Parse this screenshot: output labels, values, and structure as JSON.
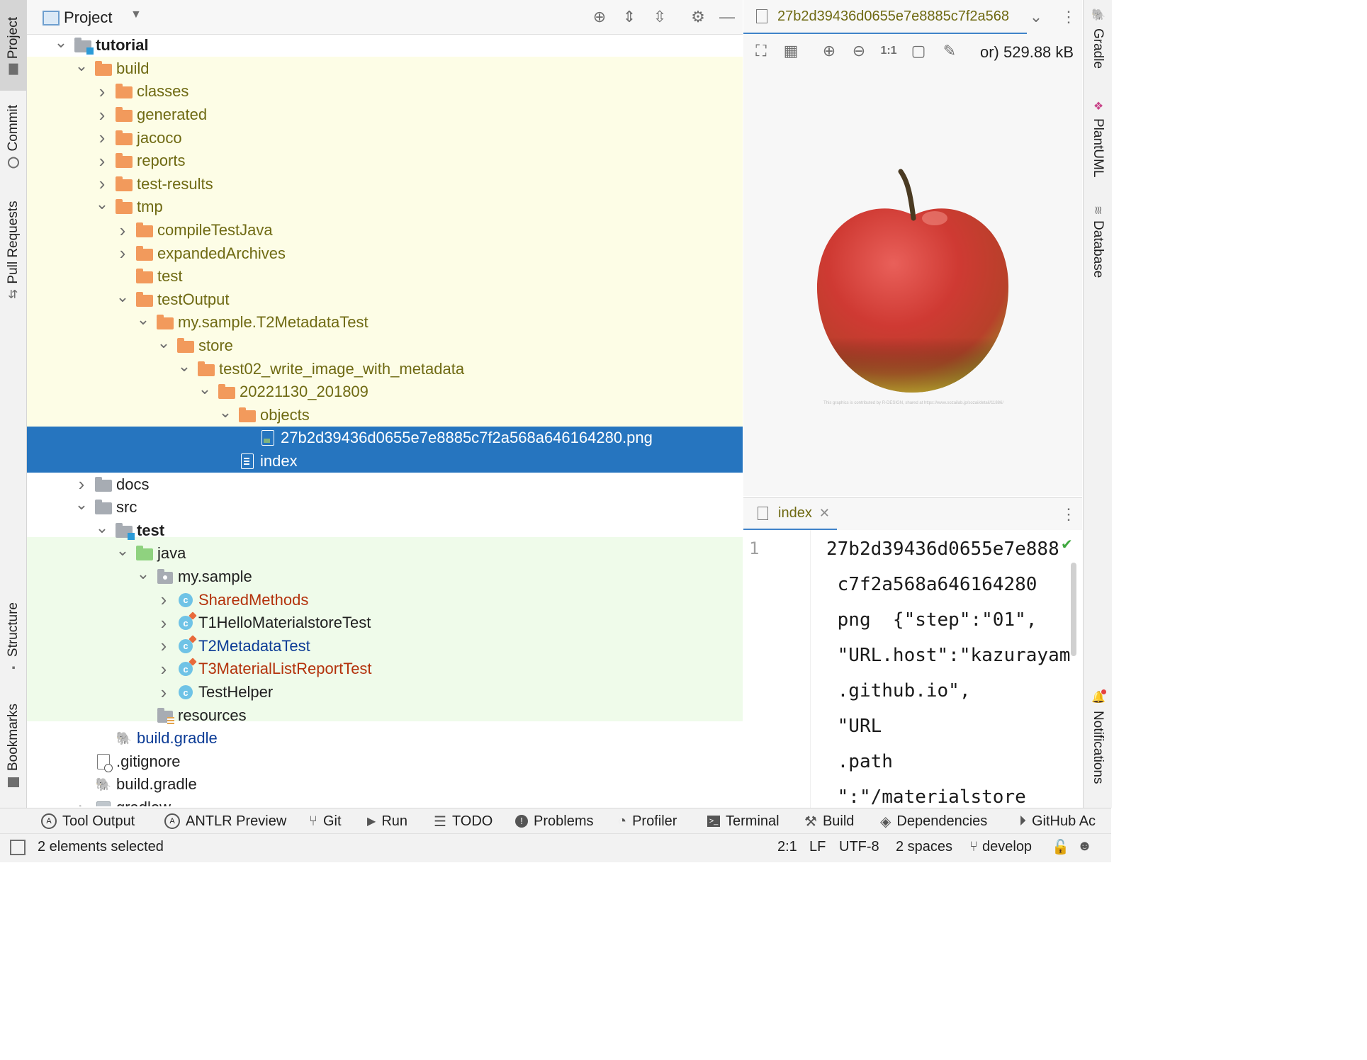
{
  "left_strip": {
    "tabs": [
      {
        "label": "Project",
        "icon": "folder-icon"
      },
      {
        "label": "Commit",
        "icon": "commit-icon"
      },
      {
        "label": "Pull Requests",
        "icon": "pull-request-icon"
      },
      {
        "label": "Structure",
        "icon": "structure-icon"
      },
      {
        "label": "Bookmarks",
        "icon": "bookmark-icon"
      }
    ]
  },
  "right_strip": {
    "tabs": [
      {
        "label": "Gradle",
        "icon": "gradle-icon"
      },
      {
        "label": "PlantUML",
        "icon": "plantuml-icon"
      },
      {
        "label": "Database",
        "icon": "database-icon"
      },
      {
        "label": "Notifications",
        "icon": "bell-icon"
      }
    ]
  },
  "project_panel": {
    "title": "Project",
    "tree": [
      {
        "label": "tutorial",
        "depth": 1,
        "expand": "open",
        "icon": "module",
        "style": "bold"
      },
      {
        "label": "build",
        "depth": 2,
        "expand": "open",
        "icon": "folder-orange",
        "style": "olive"
      },
      {
        "label": "classes",
        "depth": 3,
        "expand": "closed",
        "icon": "folder-orange",
        "style": "olive"
      },
      {
        "label": "generated",
        "depth": 3,
        "expand": "closed",
        "icon": "folder-orange",
        "style": "olive"
      },
      {
        "label": "jacoco",
        "depth": 3,
        "expand": "closed",
        "icon": "folder-orange",
        "style": "olive"
      },
      {
        "label": "reports",
        "depth": 3,
        "expand": "closed",
        "icon": "folder-orange",
        "style": "olive"
      },
      {
        "label": "test-results",
        "depth": 3,
        "expand": "closed",
        "icon": "folder-orange",
        "style": "olive"
      },
      {
        "label": "tmp",
        "depth": 3,
        "expand": "open",
        "icon": "folder-orange",
        "style": "olive"
      },
      {
        "label": "compileTestJava",
        "depth": 4,
        "expand": "closed",
        "icon": "folder-orange",
        "style": "olive"
      },
      {
        "label": "expandedArchives",
        "depth": 4,
        "expand": "closed",
        "icon": "folder-orange",
        "style": "olive"
      },
      {
        "label": "test",
        "depth": 4,
        "expand": "none",
        "icon": "folder-orange",
        "style": "olive"
      },
      {
        "label": "testOutput",
        "depth": 4,
        "expand": "open",
        "icon": "folder-orange",
        "style": "olive"
      },
      {
        "label": "my.sample.T2MetadataTest",
        "depth": 5,
        "expand": "open",
        "icon": "folder-orange",
        "style": "olive"
      },
      {
        "label": "store",
        "depth": 6,
        "expand": "open",
        "icon": "folder-orange",
        "style": "olive"
      },
      {
        "label": "test02_write_image_with_metadata",
        "depth": 7,
        "expand": "open",
        "icon": "folder-orange",
        "style": "olive"
      },
      {
        "label": "20221130_201809",
        "depth": 8,
        "expand": "open",
        "icon": "folder-orange",
        "style": "olive"
      },
      {
        "label": "objects",
        "depth": 9,
        "expand": "open",
        "icon": "folder-orange",
        "style": "olive"
      },
      {
        "label": "27b2d39436d0655e7e8885c7f2a568a646164280.png",
        "depth": 10,
        "expand": "none",
        "icon": "image-file",
        "style": "selected"
      },
      {
        "label": "index",
        "depth": 9,
        "expand": "none",
        "icon": "text-file",
        "style": "selected"
      },
      {
        "label": "docs",
        "depth": 2,
        "expand": "closed",
        "icon": "folder-gray",
        "style": "dark"
      },
      {
        "label": "src",
        "depth": 2,
        "expand": "open",
        "icon": "folder-gray",
        "style": "dark"
      },
      {
        "label": "test",
        "depth": 3,
        "expand": "open",
        "icon": "module",
        "style": "bold"
      },
      {
        "label": "java",
        "depth": 4,
        "expand": "open",
        "icon": "folder-green",
        "style": "dark"
      },
      {
        "label": "my.sample",
        "depth": 5,
        "expand": "open",
        "icon": "package",
        "style": "dark"
      },
      {
        "label": "SharedMethods",
        "depth": 6,
        "expand": "closed",
        "icon": "class",
        "style": "red"
      },
      {
        "label": "T1HelloMaterialstoreTest",
        "depth": 6,
        "expand": "closed",
        "icon": "test-class",
        "style": "dark"
      },
      {
        "label": "T2MetadataTest",
        "depth": 6,
        "expand": "closed",
        "icon": "test-class",
        "style": "blue"
      },
      {
        "label": "T3MaterialListReportTest",
        "depth": 6,
        "expand": "closed",
        "icon": "test-class",
        "style": "red"
      },
      {
        "label": "TestHelper",
        "depth": 6,
        "expand": "closed",
        "icon": "class",
        "style": "dark"
      },
      {
        "label": "resources",
        "depth": 5,
        "expand": "none",
        "icon": "resources",
        "style": "dark"
      },
      {
        "label": "build.gradle",
        "depth": 3,
        "expand": "none",
        "icon": "gradle",
        "style": "blue"
      },
      {
        "label": ".gitignore",
        "depth": 2,
        "expand": "none",
        "icon": "ignore-file",
        "style": "dark"
      },
      {
        "label": "build.gradle",
        "depth": 2,
        "expand": "none",
        "icon": "gradle",
        "style": "dark"
      },
      {
        "label": "gradlew",
        "depth": 2,
        "expand": "closed",
        "icon": "script-file",
        "style": "dark"
      }
    ]
  },
  "image_viewer": {
    "tab_title": "27b2d39436d0655e7e8885c7f2a568",
    "file_size_text": "or) 529.88 kB",
    "zoom_actual": "1:1",
    "credit_text": "This graphics is contributed by R-DESIGN, shared at https://www.sozailab.jp/sozai/detail/11886/"
  },
  "editor": {
    "tab_title": "index",
    "line_number": "1",
    "lines": [
      "27b2d39436d0655e7e888",
      " c7f2a568a646164280",
      " png  {\"step\":\"01\",",
      " \"URL.host\":\"kazurayam",
      " .github.io\",",
      " \"URL",
      " .path",
      " \":\"/materialstore"
    ]
  },
  "bottom_tabs": [
    {
      "label": "Tool Output",
      "icon": "antlr-icon"
    },
    {
      "label": "ANTLR Preview",
      "icon": "antlr-icon"
    },
    {
      "label": "Git",
      "icon": "git-branch-icon"
    },
    {
      "label": "Run",
      "icon": "run-icon"
    },
    {
      "label": "TODO",
      "icon": "todo-icon"
    },
    {
      "label": "Problems",
      "icon": "problems-icon"
    },
    {
      "label": "Profiler",
      "icon": "profiler-icon"
    },
    {
      "label": "Terminal",
      "icon": "terminal-icon"
    },
    {
      "label": "Build",
      "icon": "hammer-icon"
    },
    {
      "label": "Dependencies",
      "icon": "layers-icon"
    },
    {
      "label": "GitHub Ac",
      "icon": "github-actions-icon"
    }
  ],
  "status_bar": {
    "message": "2 elements selected",
    "position": "2:1",
    "line_separator": "LF",
    "encoding": "UTF-8",
    "indent": "2 spaces",
    "branch": "develop"
  },
  "colors": {
    "selection": "#2675bf",
    "build_bg": "#fdfde6",
    "test_bg": "#effbea",
    "folder_orange": "#f29a5c"
  }
}
